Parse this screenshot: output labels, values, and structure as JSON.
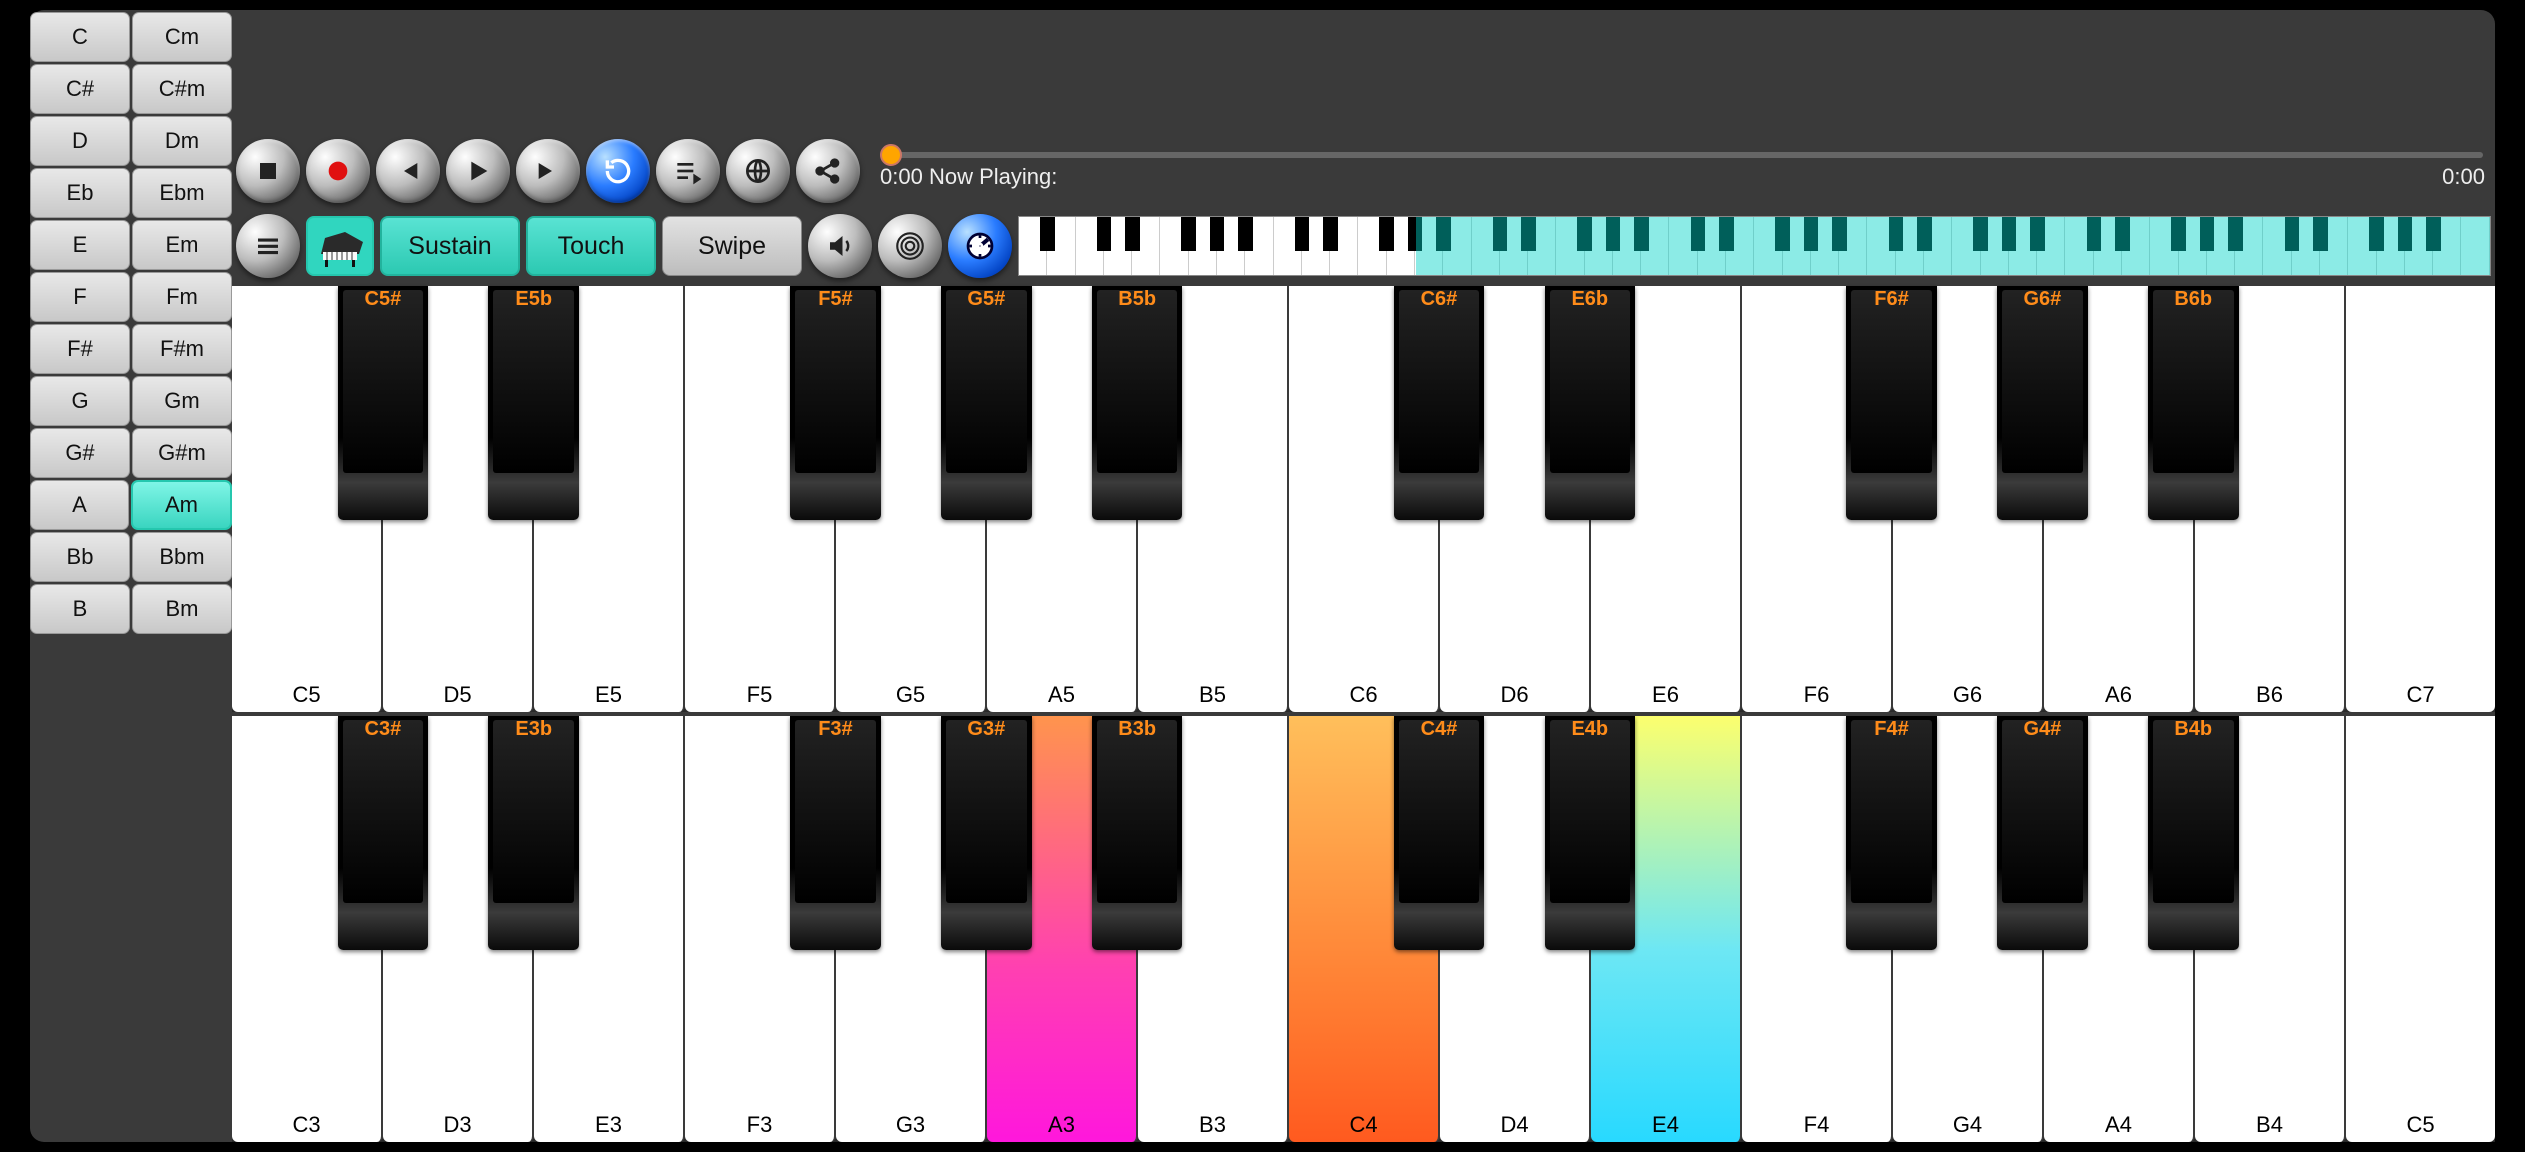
{
  "chords": {
    "rows": [
      {
        "maj": "C",
        "min": "Cm"
      },
      {
        "maj": "C#",
        "min": "C#m"
      },
      {
        "maj": "D",
        "min": "Dm"
      },
      {
        "maj": "Eb",
        "min": "Ebm"
      },
      {
        "maj": "E",
        "min": "Em"
      },
      {
        "maj": "F",
        "min": "Fm"
      },
      {
        "maj": "F#",
        "min": "F#m"
      },
      {
        "maj": "G",
        "min": "Gm"
      },
      {
        "maj": "G#",
        "min": "G#m"
      },
      {
        "maj": "A",
        "min": "Am"
      },
      {
        "maj": "Bb",
        "min": "Bbm"
      },
      {
        "maj": "B",
        "min": "Bm"
      }
    ],
    "active": "Am"
  },
  "transport": {
    "time_current": "0:00",
    "now_playing_label": "Now Playing:",
    "time_total": "0:00"
  },
  "controls": {
    "sustain_label": "Sustain",
    "touch_label": "Touch",
    "swipe_label": "Swipe"
  },
  "keyboard_top": {
    "white": [
      "C5",
      "D5",
      "E5",
      "F5",
      "G5",
      "A5",
      "B5",
      "C6",
      "D6",
      "E6",
      "F6",
      "G6",
      "A6",
      "B6",
      "C7"
    ],
    "black": [
      {
        "label": "C5#",
        "pos": 0
      },
      {
        "label": "E5b",
        "pos": 1
      },
      {
        "label": "F5#",
        "pos": 3
      },
      {
        "label": "G5#",
        "pos": 4
      },
      {
        "label": "B5b",
        "pos": 5
      },
      {
        "label": "C6#",
        "pos": 7
      },
      {
        "label": "E6b",
        "pos": 8
      },
      {
        "label": "F6#",
        "pos": 10
      },
      {
        "label": "G6#",
        "pos": 11
      },
      {
        "label": "B6b",
        "pos": 12
      }
    ],
    "highlighted": []
  },
  "keyboard_bottom": {
    "white": [
      "C3",
      "D3",
      "E3",
      "F3",
      "G3",
      "A3",
      "B3",
      "C4",
      "D4",
      "E4",
      "F4",
      "G4",
      "A4",
      "B4",
      "C5"
    ],
    "black": [
      {
        "label": "C3#",
        "pos": 0
      },
      {
        "label": "E3b",
        "pos": 1
      },
      {
        "label": "F3#",
        "pos": 3
      },
      {
        "label": "G3#",
        "pos": 4
      },
      {
        "label": "B3b",
        "pos": 5
      },
      {
        "label": "C4#",
        "pos": 7
      },
      {
        "label": "E4b",
        "pos": 8
      },
      {
        "label": "F4#",
        "pos": 10
      },
      {
        "label": "G4#",
        "pos": 11
      },
      {
        "label": "B4b",
        "pos": 12
      }
    ],
    "highlighted": [
      {
        "note": "A3",
        "style": "hl-pink"
      },
      {
        "note": "C4",
        "style": "hl-orange"
      },
      {
        "note": "E4",
        "style": "hl-cyan"
      }
    ]
  },
  "mini_keyboard": {
    "white_count": 52,
    "highlight": {
      "start_pct": 27,
      "width_pct": 73
    }
  }
}
